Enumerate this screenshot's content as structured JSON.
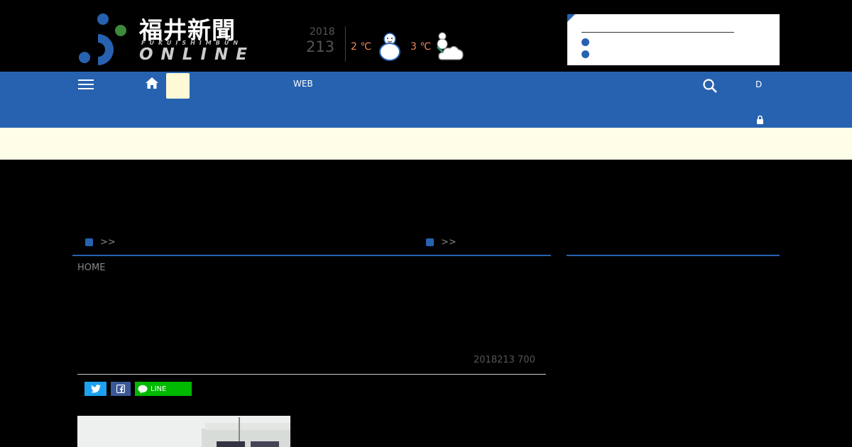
{
  "brand": {
    "kanji": "福井新聞",
    "romaji": "FUKUISHIMBUN",
    "online": "ONLINE",
    "colors": {
      "blue": "#2762b0",
      "green": "#3d8a3a",
      "orange": "#f08a5d"
    }
  },
  "weather": {
    "year": "2018",
    "date": "213",
    "temp1": "2 ℃",
    "temp2": "3 ℃",
    "icon1": "snowman-icon",
    "icon2": "snow-cloud-icon"
  },
  "notice": {
    "items": [
      {
        "label": ""
      },
      {
        "label": ""
      }
    ]
  },
  "nav": {
    "web_label": "WEB",
    "dlink_label": "D"
  },
  "sections": {
    "left_arrow": ">>",
    "right_arrow": ">>"
  },
  "article": {
    "breadcrumb": "HOME",
    "date": "2018213 700"
  },
  "share": {
    "line_label": "LINE"
  }
}
